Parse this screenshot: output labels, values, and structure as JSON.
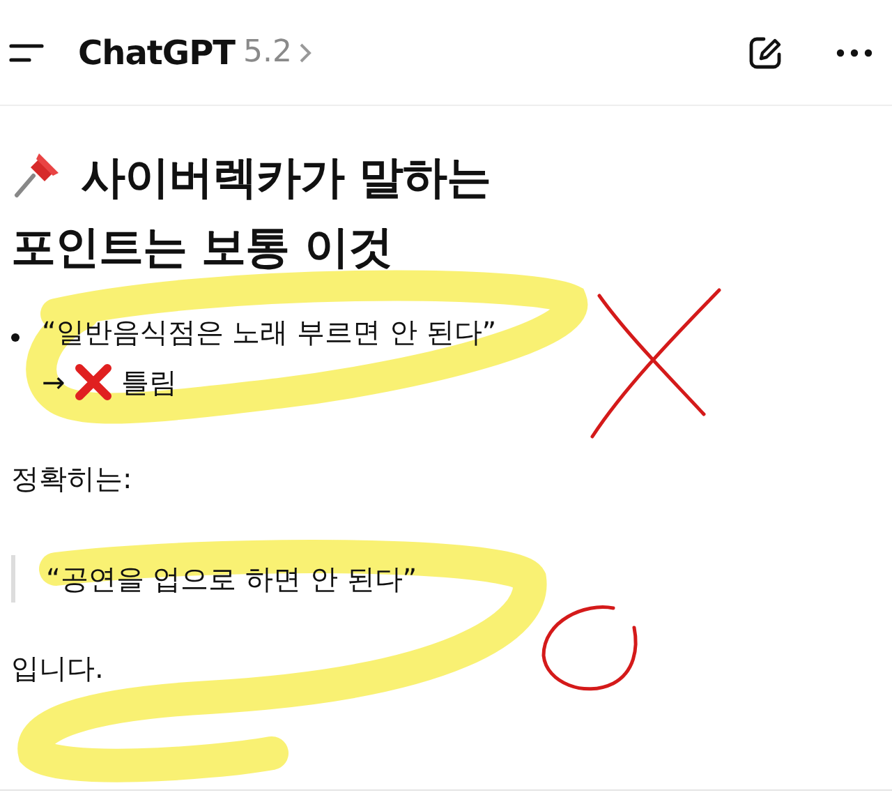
{
  "header": {
    "title": "ChatGPT",
    "version": "5.2"
  },
  "heading": {
    "lines": [
      "사이버렉카가 말하는",
      "포인트는 보통 이것"
    ]
  },
  "bullet": {
    "quote": "“일반음식점은 노래 부르면 안 된다”",
    "arrow": "→",
    "verdict": "틀림"
  },
  "lead": "정확히는:",
  "blockquote": "“공연을 업으로 하면 안 된다”",
  "closing": "입니다."
}
